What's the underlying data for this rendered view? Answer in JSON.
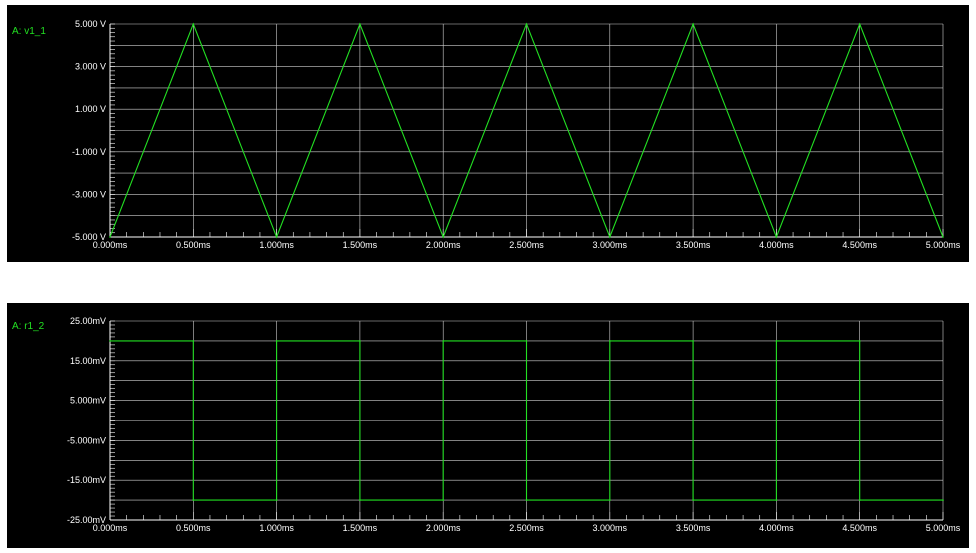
{
  "colors": {
    "background": "#000000",
    "grid": "#d0d0d0",
    "trace": "#22e022",
    "text": "#ffffff",
    "label": "#22e022"
  },
  "chart_data": [
    {
      "type": "line",
      "trace_label": "A: v1_1",
      "xlim": [
        0,
        5
      ],
      "ylim": [
        -5,
        5
      ],
      "xtick_labels": [
        "0.000ms",
        "0.500ms",
        "1.000ms",
        "1.500ms",
        "2.000ms",
        "2.500ms",
        "3.000ms",
        "3.500ms",
        "4.000ms",
        "4.500ms",
        "5.000ms"
      ],
      "ytick_labels": [
        "5.000 V",
        "3.000 V",
        "1.000 V",
        "-1.000 V",
        "-3.000 V",
        "-5.000 V"
      ],
      "grid": true,
      "series": [
        {
          "x": [
            0,
            0.5,
            1.0,
            1.5,
            2.0,
            2.5,
            3.0,
            3.5,
            4.0,
            4.5,
            5.0
          ],
          "y": [
            -5,
            5,
            -5,
            5,
            -5,
            5,
            -5,
            5,
            -5,
            5,
            -5
          ]
        }
      ]
    },
    {
      "type": "line",
      "trace_label": "A: r1_2",
      "xlim": [
        0,
        5
      ],
      "ylim": [
        -25,
        25
      ],
      "xtick_labels": [
        "0.000ms",
        "0.500ms",
        "1.000ms",
        "1.500ms",
        "2.000ms",
        "2.500ms",
        "3.000ms",
        "3.500ms",
        "4.000ms",
        "4.500ms",
        "5.000ms"
      ],
      "ytick_labels": [
        "25.00mV",
        "15.00mV",
        "5.000mV",
        "-5.000mV",
        "-15.00mV",
        "-25.00mV"
      ],
      "grid": true,
      "series": [
        {
          "x": [
            0,
            0.5,
            0.5,
            1.0,
            1.0,
            1.5,
            1.5,
            2.0,
            2.0,
            2.5,
            2.5,
            3.0,
            3.0,
            3.5,
            3.5,
            4.0,
            4.0,
            4.5,
            4.5,
            5.0
          ],
          "y": [
            20,
            20,
            -20,
            -20,
            20,
            20,
            -20,
            -20,
            20,
            20,
            -20,
            -20,
            20,
            20,
            -20,
            -20,
            20,
            20,
            -20,
            -20
          ]
        }
      ]
    }
  ]
}
